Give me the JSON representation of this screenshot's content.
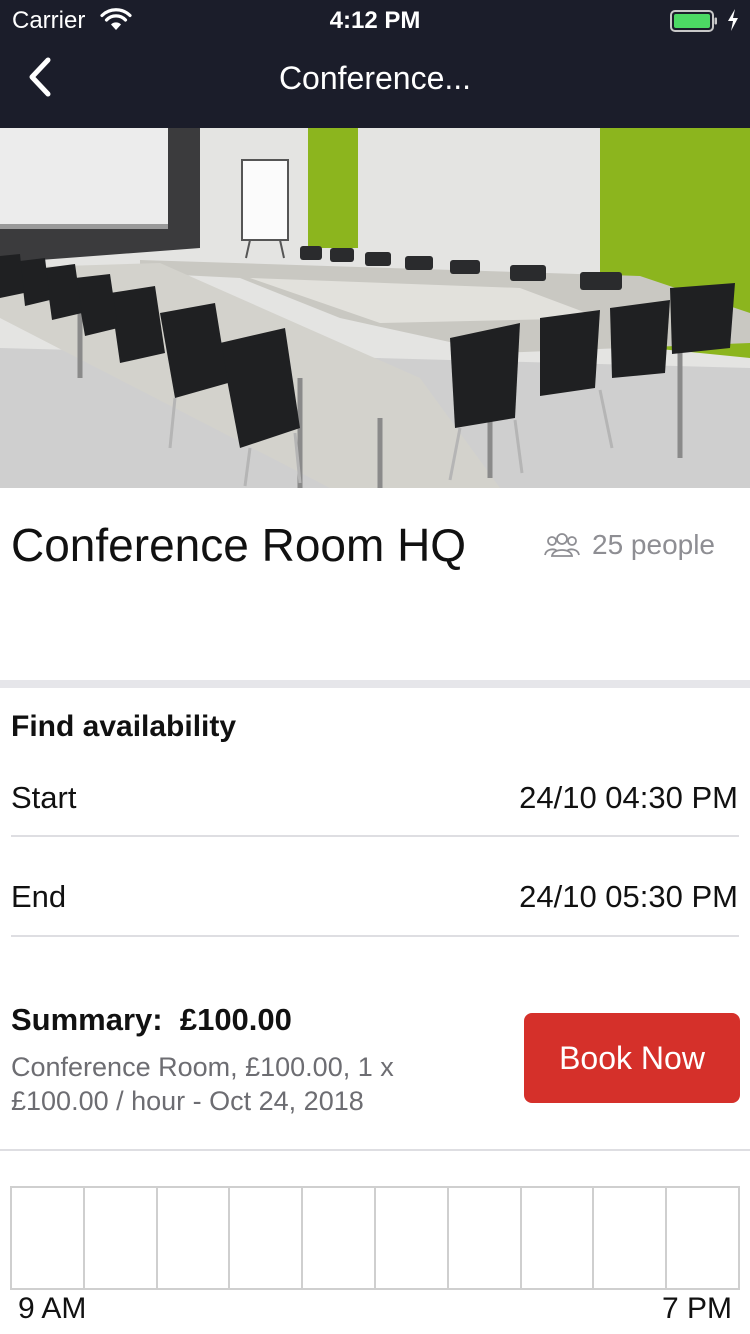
{
  "status_bar": {
    "carrier": "Carrier",
    "time": "4:12 PM",
    "battery_color": "#4cd964"
  },
  "nav": {
    "back_icon": "chevron-left-icon",
    "title": "Conference..."
  },
  "hero_image": {
    "description_icon": "conference-room-photo"
  },
  "room": {
    "name": "Conference Room HQ",
    "capacity": "25 people",
    "capacity_icon": "people-group-icon"
  },
  "availability": {
    "title": "Find availability",
    "start_label": "Start",
    "start_value": "24/10 04:30 PM",
    "end_label": "End",
    "end_value": "24/10 05:30 PM"
  },
  "summary": {
    "label": "Summary:  £100.00",
    "detail": "Conference Room, £100.00, 1 x £100.00 / hour - Oct 24, 2018",
    "book_button": "Book Now",
    "accent_color": "#d5302a"
  },
  "timeline": {
    "slots": 10,
    "start_label": "9 AM",
    "end_label": "7 PM"
  }
}
